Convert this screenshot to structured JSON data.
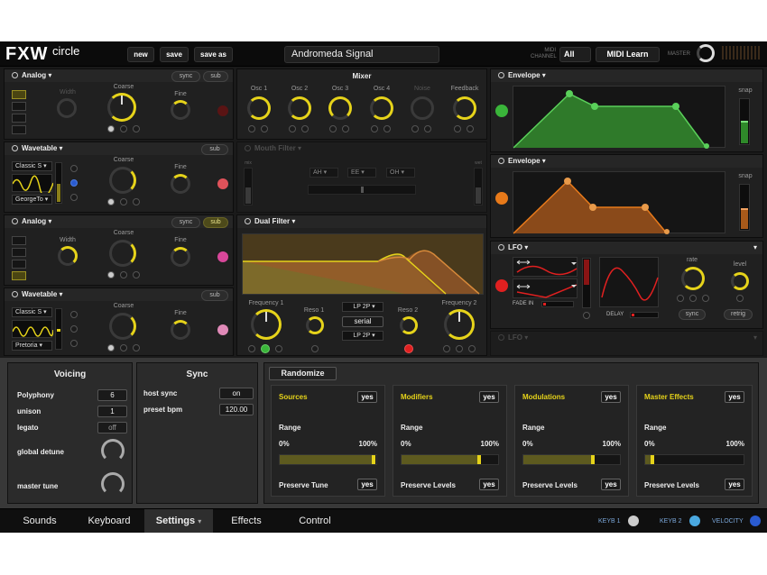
{
  "header": {
    "logo": "FXW",
    "logo_sub": "circle",
    "buttons": {
      "new": "new",
      "save": "save",
      "save_as": "save as"
    },
    "preset_name": "Andromeda Signal",
    "midi_channel_label": "MIDI CHANNEL",
    "midi_channel_value": "All",
    "midi_learn": "MIDI Learn",
    "master_label": "MASTER"
  },
  "osc1": {
    "type": "Analog",
    "sync": "sync",
    "sub": "sub",
    "width": "Width",
    "coarse": "Coarse",
    "fine": "Fine"
  },
  "osc2": {
    "type": "Wavetable",
    "sub": "sub",
    "coarse": "Coarse",
    "fine": "Fine",
    "table": "Classic S",
    "table2": "GeorgeTo"
  },
  "osc3": {
    "type": "Analog",
    "sync": "sync",
    "sub": "sub",
    "width": "Width",
    "coarse": "Coarse",
    "fine": "Fine"
  },
  "osc4": {
    "type": "Wavetable",
    "sub": "sub",
    "coarse": "Coarse",
    "fine": "Fine",
    "table": "Classic S",
    "table2": "Pretoria"
  },
  "mixer": {
    "title": "Mixer",
    "channels": [
      "Osc 1",
      "Osc 2",
      "Osc 3",
      "Osc 4",
      "Noise",
      "Feedback"
    ]
  },
  "mouth_filter": {
    "title": "Mouth Filter",
    "vowels": [
      "AH",
      "EE",
      "OH"
    ],
    "left": "mix",
    "right": "wet"
  },
  "dual_filter": {
    "title": "Dual Filter",
    "freq1": "Frequency 1",
    "reso1": "Reso 1",
    "reso2": "Reso 2",
    "freq2": "Frequency 2",
    "type1": "LP 2P",
    "mode": "serial",
    "type2": "LP 2P"
  },
  "env1": {
    "title": "Envelope",
    "snap": "snap"
  },
  "env2": {
    "title": "Envelope",
    "snap": "snap"
  },
  "lfo1": {
    "title": "LFO",
    "fade_in": "FADE IN",
    "delay": "DELAY",
    "rate": "rate",
    "level": "level",
    "sync": "sync",
    "retrig": "retrig"
  },
  "lfo2": {
    "title": "LFO"
  },
  "voicing": {
    "title": "Voicing",
    "polyphony_label": "Polyphony",
    "polyphony": "6",
    "unison_label": "unison",
    "unison": "1",
    "legato_label": "legato",
    "legato": "off",
    "detune_label": "global detune",
    "tune_label": "master tune"
  },
  "sync": {
    "title": "Sync",
    "host_label": "host sync",
    "host": "on",
    "bpm_label": "preset bpm",
    "bpm": "120.00"
  },
  "randomize": {
    "button": "Randomize",
    "cards": [
      {
        "title": "Sources",
        "yes": "yes",
        "range": "Range",
        "min": "0%",
        "max": "100%",
        "preserve": "Preserve Tune",
        "preserve_val": "yes",
        "fill": 0.99
      },
      {
        "title": "Modifiers",
        "yes": "yes",
        "range": "Range",
        "min": "0%",
        "max": "100%",
        "preserve": "Preserve Levels",
        "preserve_val": "yes",
        "fill": 0.82
      },
      {
        "title": "Modulations",
        "yes": "yes",
        "range": "Range",
        "min": "0%",
        "max": "100%",
        "preserve": "Preserve Levels",
        "preserve_val": "yes",
        "fill": 0.74
      },
      {
        "title": "Master Effects",
        "yes": "yes",
        "range": "Range",
        "min": "0%",
        "max": "100%",
        "preserve": "Preserve Levels",
        "preserve_val": "yes",
        "fill": 0.09
      }
    ]
  },
  "tabs": [
    "Sounds",
    "Keyboard",
    "Settings",
    "Effects",
    "Control"
  ],
  "footer": {
    "keyb1": "KEYB 1",
    "keyb2": "KEYB 2",
    "velocity": "VELOCITY"
  },
  "colors": {
    "accent": "#e6d31a",
    "env1": "#3ab53a",
    "env2": "#e87a1a",
    "lfo": "#e02020",
    "osc2_led": "#e0525a",
    "osc3_led": "#d8479a",
    "osc4_led": "#e08ab8"
  }
}
